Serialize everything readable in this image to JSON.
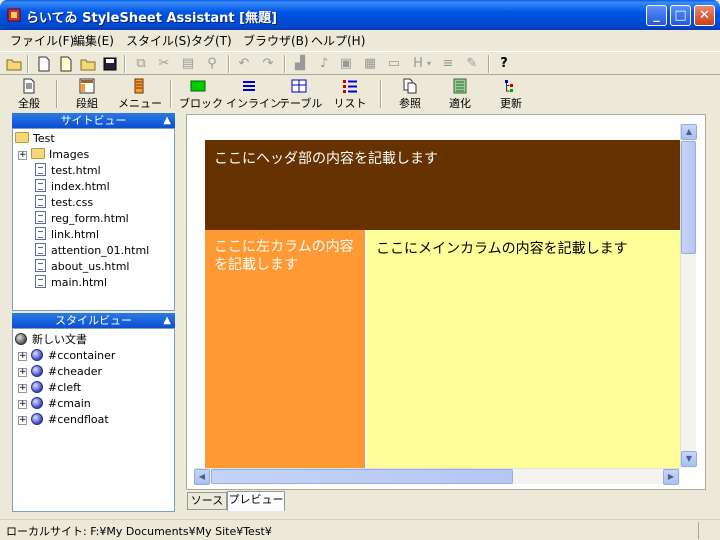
{
  "window": {
    "title": "らいてゐ StyleSheet Assistant [無題]"
  },
  "menu": [
    "ファイル(F)",
    "編集(E)",
    "スタイル(S)",
    "タグ(T)",
    "ブラウザ(B)",
    "ヘルプ(H)"
  ],
  "toolbar2": [
    {
      "label": "全般",
      "icon": "document-icon"
    },
    {
      "label": "段組",
      "icon": "columns-icon"
    },
    {
      "label": "メニュー",
      "icon": "menu-icon"
    },
    {
      "label": "ブロック",
      "icon": "block-icon"
    },
    {
      "label": "インライン",
      "icon": "inline-icon"
    },
    {
      "label": "テーブル",
      "icon": "table-icon"
    },
    {
      "label": "リスト",
      "icon": "list-icon"
    },
    {
      "label": "参照",
      "icon": "reference-icon"
    },
    {
      "label": "適化",
      "icon": "optimize-icon"
    },
    {
      "label": "更新",
      "icon": "refresh-icon"
    }
  ],
  "site_view": {
    "title": "サイトビュー",
    "root": "Test",
    "folder": "Images",
    "files": [
      "test.html",
      "index.html",
      "test.css",
      "reg_form.html",
      "link.html",
      "attention_01.html",
      "about_us.html",
      "main.html"
    ]
  },
  "style_view": {
    "title": "スタイルビュー",
    "root": "新しい文書",
    "items": [
      "#ccontainer",
      "#cheader",
      "#cleft",
      "#cmain",
      "#cendfloat"
    ]
  },
  "preview": {
    "header_text": "ここにヘッダ部の内容を記載します",
    "left_text": "ここに左カラムの内容を記載します",
    "main_text": "ここにメインカラムの内容を記載します",
    "colors": {
      "header": "#663300",
      "left": "#ff9933",
      "main": "#ffff99"
    }
  },
  "tabs": [
    "ソース",
    "プレビュー"
  ],
  "status": {
    "text": "ローカルサイト: F:¥My Documents¥My Site¥Test¥"
  }
}
